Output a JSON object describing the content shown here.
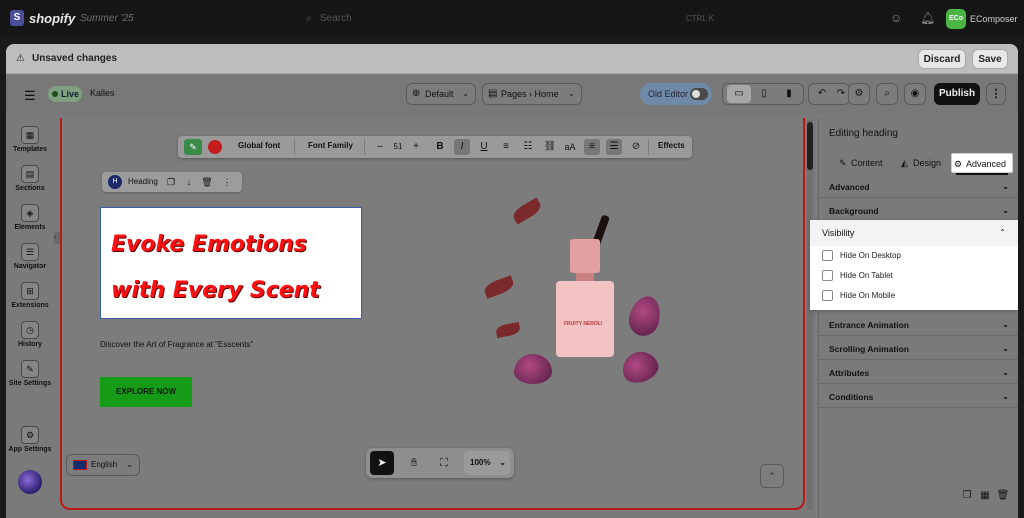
{
  "shopify": {
    "logo": "shopify",
    "season": "Summer '25",
    "search_placeholder": "Search",
    "search_shortcut": "CTRL  K",
    "store_initials": "ECo",
    "store_name": "EComposer"
  },
  "unsaved": {
    "title": "Unsaved changes",
    "discard_label": "Discard",
    "save_label": "Save"
  },
  "editor_bar": {
    "live_label": "Live",
    "theme_name": "Kalles",
    "template_select": "Default",
    "pages_label": "Pages",
    "page_label": "Home",
    "old_editor_label": "Old Editor",
    "publish_label": "Publish"
  },
  "left_rail": {
    "items": [
      {
        "label": "Templates",
        "icon": "templates-icon"
      },
      {
        "label": "Sections",
        "icon": "sections-icon"
      },
      {
        "label": "Elements",
        "icon": "elements-icon"
      },
      {
        "label": "Navigator",
        "icon": "navigator-icon"
      },
      {
        "label": "Extensions",
        "icon": "extensions-icon"
      },
      {
        "label": "History",
        "icon": "history-icon"
      },
      {
        "label": "Site Settings",
        "icon": "site-settings-icon"
      },
      {
        "label": "App Settings",
        "icon": "app-settings-icon"
      }
    ]
  },
  "text_toolbar": {
    "global_font": "Global font",
    "font_family": "Font Family",
    "minus": "–",
    "font_size": "51",
    "plus": "+",
    "bold": "B",
    "italic": "I",
    "underline": "U",
    "case": "aA",
    "effects": "Effects"
  },
  "heading_chip": {
    "label": "Heading"
  },
  "hero": {
    "heading_line1": "Evoke Emotions",
    "heading_line2": "with Every Scent",
    "subtitle": "Discover the Art of Fragrance at \"Esscents\"",
    "cta": "EXPLORE NOW",
    "bottle_name": "FRUITY NEROLI"
  },
  "bottom": {
    "language": "English",
    "zoom": "100%"
  },
  "panel": {
    "title": "Editing heading",
    "tabs": [
      {
        "label": "Content",
        "icon": "pencil-icon"
      },
      {
        "label": "Design",
        "icon": "paint-icon"
      },
      {
        "label": "Advanced",
        "icon": "gear-icon",
        "active": true
      }
    ],
    "sections_top": [
      "Advanced",
      "Background"
    ],
    "visibility": {
      "title": "Visibility",
      "options": [
        "Hide On Desktop",
        "Hide On Tablet",
        "Hide On Mobile"
      ],
      "checked": [
        false,
        false,
        false
      ]
    },
    "sections_bottom": [
      "Entrance Animation",
      "Scrolling Animation",
      "Attributes",
      "Conditions"
    ]
  },
  "colors": {
    "heading_red": "#ff1010",
    "canvas_border": "#c01818",
    "cta_green": "#169b16"
  }
}
